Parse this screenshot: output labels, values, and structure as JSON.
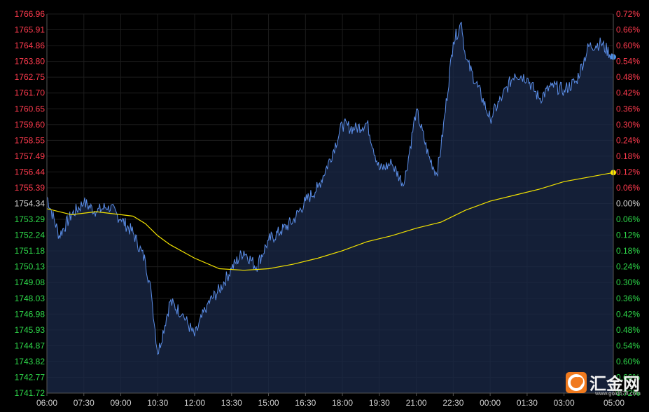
{
  "chart_data": {
    "type": "line",
    "title": "",
    "xlabel": "",
    "ylabel": "",
    "ylim": [
      1741.72,
      1766.96
    ],
    "y2lim": [
      -0.72,
      0.72
    ],
    "y_ticks": [
      "1766.96",
      "1765.91",
      "1764.86",
      "1763.80",
      "1762.75",
      "1761.70",
      "1760.65",
      "1759.60",
      "1758.55",
      "1757.49",
      "1756.44",
      "1755.39",
      "1754.34",
      "1753.29",
      "1752.24",
      "1751.18",
      "1750.13",
      "1749.08",
      "1748.03",
      "1746.98",
      "1745.93",
      "1744.87",
      "1743.82",
      "1742.77",
      "1741.72"
    ],
    "y2_ticks": [
      "0.72%",
      "0.66%",
      "0.60%",
      "0.54%",
      "0.48%",
      "0.42%",
      "0.36%",
      "0.30%",
      "0.24%",
      "0.18%",
      "0.12%",
      "0.06%",
      "0.00%",
      "0.06%",
      "0.12%",
      "0.18%",
      "0.24%",
      "0.30%",
      "0.36%",
      "0.42%",
      "0.48%",
      "0.54%",
      "0.60%",
      "0.66%",
      "0.72%"
    ],
    "x_ticks": [
      "06:00",
      "07:30",
      "09:00",
      "10:30",
      "12:00",
      "13:30",
      "15:00",
      "16:30",
      "18:00",
      "19:30",
      "21:00",
      "22:30",
      "00:00",
      "01:30",
      "03:00",
      "05:00"
    ],
    "grid": true,
    "colors": {
      "background": "#000000",
      "grid": "#1c1c1c",
      "axis": "#555555",
      "y_up": "#ff3b4e",
      "y_neutral": "#d6d6d6",
      "y_down": "#2ed84a",
      "x_label": "#cfcfcf",
      "price_line": "#5b8ee8",
      "area_fill": "#1b2a4a",
      "average_line": "#f2e200",
      "price_dot": "#4a8fe8",
      "average_dot": "#ffe800"
    },
    "series": [
      {
        "key": "price",
        "x": [
          "06:00",
          "06:30",
          "07:00",
          "07:30",
          "08:00",
          "08:30",
          "09:00",
          "09:30",
          "10:00",
          "10:15",
          "10:30",
          "11:00",
          "11:30",
          "12:00",
          "12:30",
          "13:00",
          "13:30",
          "14:00",
          "14:30",
          "15:00",
          "15:30",
          "16:00",
          "16:30",
          "17:00",
          "17:30",
          "18:00",
          "18:30",
          "19:00",
          "19:30",
          "20:00",
          "20:30",
          "21:00",
          "21:30",
          "21:50",
          "22:00",
          "22:30",
          "22:50",
          "23:00",
          "23:30",
          "00:00",
          "00:30",
          "01:00",
          "01:30",
          "02:00",
          "02:30",
          "03:00",
          "03:30",
          "04:00",
          "04:30",
          "05:00"
        ],
        "values": [
          1754.8,
          1752.2,
          1753.6,
          1754.4,
          1753.8,
          1754.2,
          1753.3,
          1752.4,
          1750.5,
          1748.2,
          1744.3,
          1747.8,
          1747.0,
          1745.5,
          1747.6,
          1748.6,
          1750.0,
          1751.2,
          1750.1,
          1751.9,
          1752.5,
          1753.2,
          1754.5,
          1755.4,
          1757.3,
          1759.6,
          1759.3,
          1759.7,
          1756.6,
          1757.0,
          1755.6,
          1760.6,
          1757.5,
          1756.3,
          1758.0,
          1765.1,
          1766.4,
          1764.0,
          1762.1,
          1760.0,
          1761.5,
          1763.0,
          1762.7,
          1761.3,
          1762.2,
          1761.9,
          1762.5,
          1764.8,
          1765.0,
          1764.1
        ]
      },
      {
        "key": "average",
        "x": [
          "06:00",
          "07:00",
          "08:00",
          "09:00",
          "09:30",
          "10:00",
          "10:30",
          "11:00",
          "12:00",
          "13:00",
          "14:00",
          "15:00",
          "16:00",
          "17:00",
          "18:00",
          "19:00",
          "20:00",
          "21:00",
          "22:00",
          "23:00",
          "00:00",
          "01:00",
          "02:00",
          "03:00",
          "04:00",
          "05:00"
        ],
        "values": [
          1754.0,
          1753.6,
          1753.8,
          1753.6,
          1753.5,
          1753.0,
          1752.2,
          1751.6,
          1750.7,
          1750.0,
          1749.9,
          1750.0,
          1750.3,
          1750.7,
          1751.2,
          1751.8,
          1752.2,
          1752.7,
          1753.1,
          1753.9,
          1754.5,
          1754.9,
          1755.3,
          1755.8,
          1756.1,
          1756.4
        ]
      }
    ]
  },
  "watermark": {
    "brand": "汇金网",
    "url": "www.gold678.com",
    "logo_icon": "hjw-logo-icon"
  }
}
